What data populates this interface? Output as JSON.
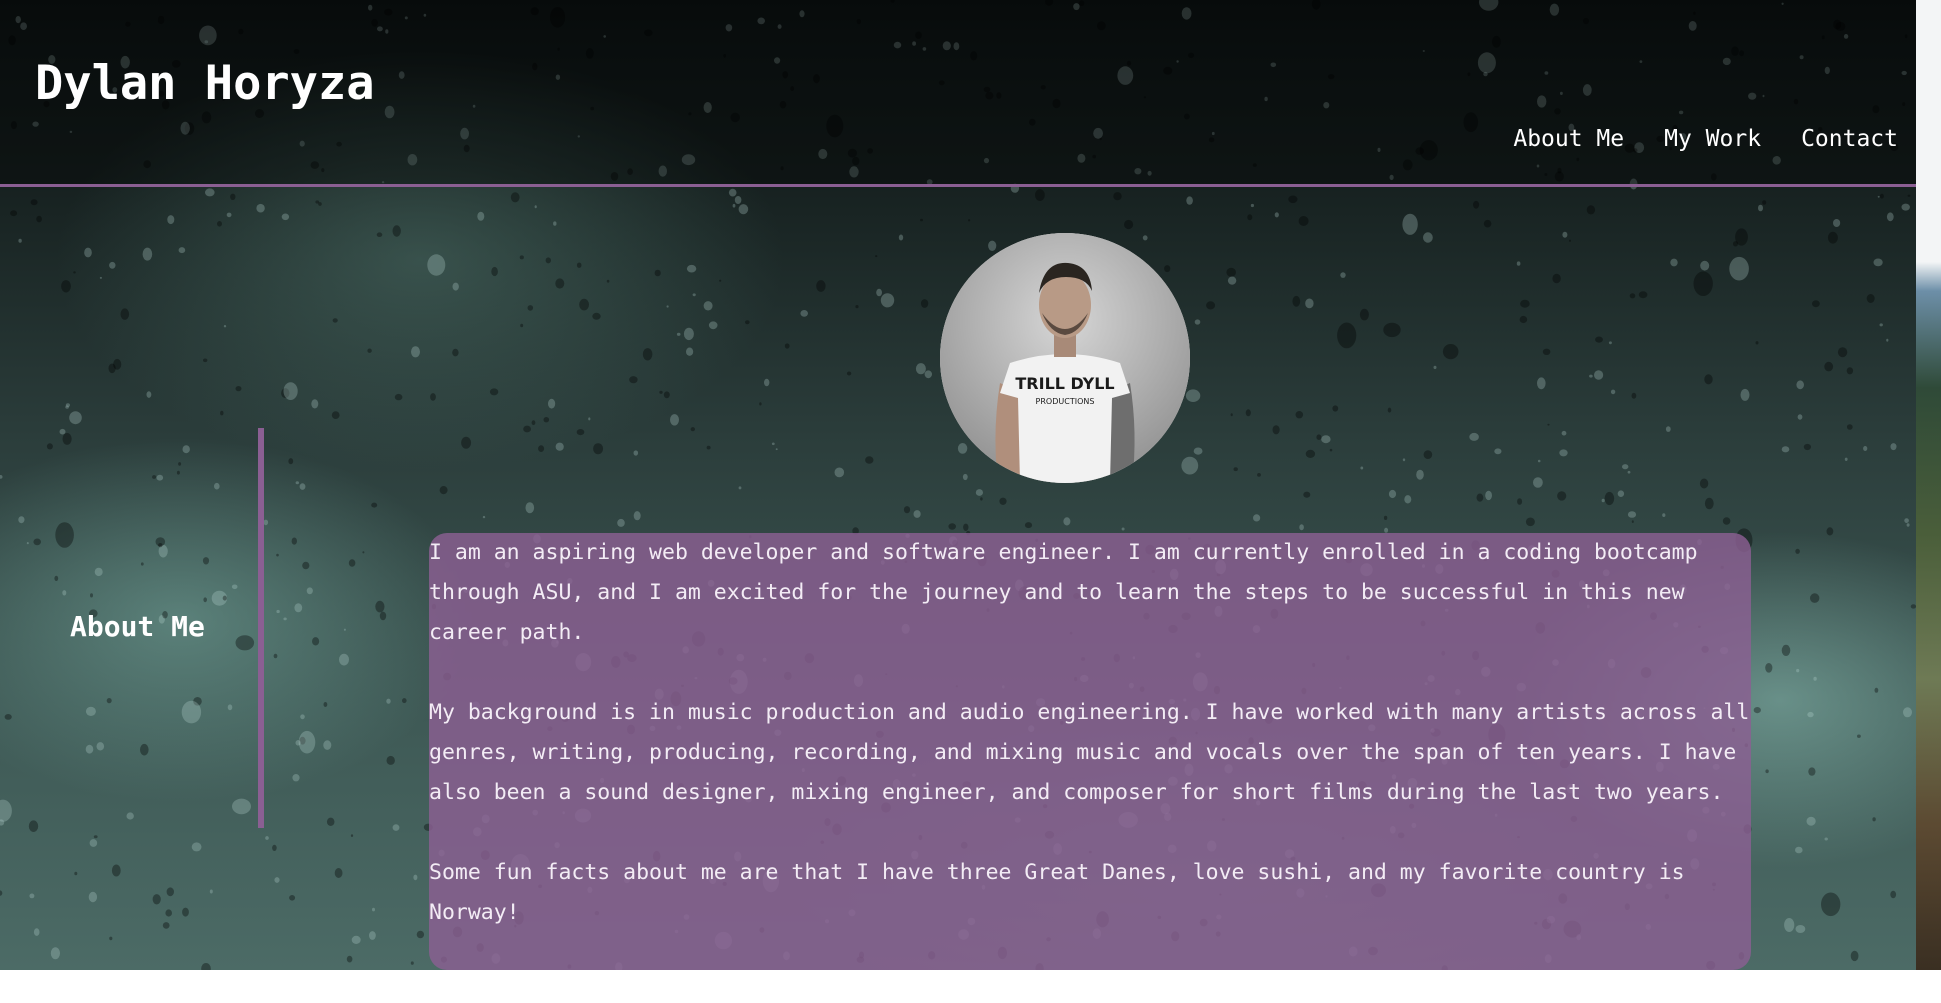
{
  "header": {
    "brand": "Dylan Horyza",
    "nav": [
      "About Me",
      "My Work",
      "Contact"
    ]
  },
  "profile": {
    "shirt_text_line1": "TRILL DYLL",
    "shirt_text_line2": "PRODUCTIONS"
  },
  "about": {
    "heading": "About Me",
    "paragraphs": [
      "I am an aspiring web developer and software engineer. I am currently enrolled in a coding bootcamp through ASU, and I am excited for the journey and to learn the steps to be successful in this new career path.",
      "My background is in music production and audio engineering. I have worked with many artists across all genres, writing, producing, recording, and mixing music and vocals over the span of ten years. I have also been a sound designer, mixing engineer, and composer for short films during the last two years.",
      "Some fun facts about me are that I have three Great Danes, love sushi, and my favorite country is Norway!"
    ]
  },
  "colors": {
    "accent": "#8b5f93",
    "text": "#ffffff"
  }
}
